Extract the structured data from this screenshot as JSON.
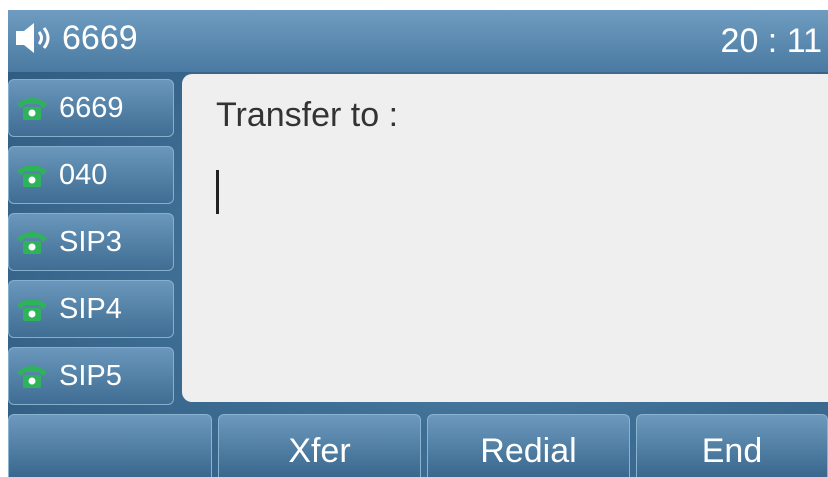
{
  "status": {
    "account": "6669",
    "time": "20 : 11",
    "speaker_icon": "speaker-icon"
  },
  "lines": [
    {
      "label": "6669",
      "icon": "phone-icon"
    },
    {
      "label": "040",
      "icon": "phone-icon"
    },
    {
      "label": "SIP3",
      "icon": "phone-icon"
    },
    {
      "label": "SIP4",
      "icon": "phone-icon"
    },
    {
      "label": "SIP5",
      "icon": "phone-icon"
    }
  ],
  "main": {
    "prompt": "Transfer to :",
    "input_value": ""
  },
  "softkeys": [
    {
      "label": ""
    },
    {
      "label": "Xfer"
    },
    {
      "label": "Redial"
    },
    {
      "label": "End"
    }
  ],
  "colors": {
    "phone_icon": "#2fb35a",
    "background": "#3f6f95",
    "content_panel": "#efefef"
  }
}
